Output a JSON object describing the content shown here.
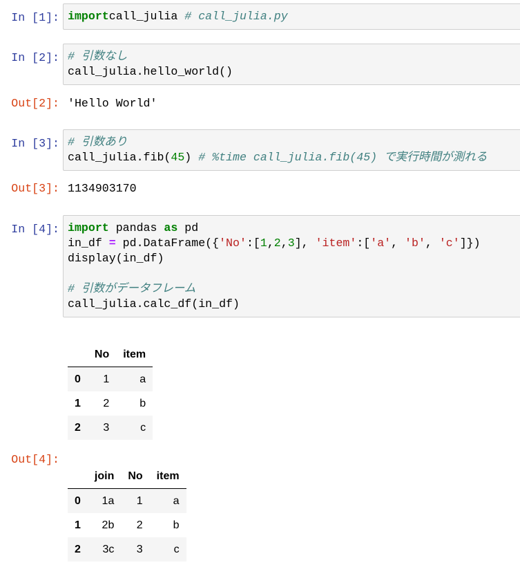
{
  "cells": [
    {
      "prompt": "In [1]:",
      "lines": [
        [
          [
            "kw",
            "import"
          ],
          [
            "",
            "call_julia "
          ],
          [
            "cm",
            "# call_julia.py"
          ]
        ]
      ]
    },
    {
      "prompt": "In [2]:",
      "lines": [
        [
          [
            "cm",
            "# 引数なし"
          ]
        ],
        [
          [
            "",
            "call_julia.hello_world()"
          ]
        ]
      ],
      "out_prompt": "Out[2]:",
      "output": "'Hello World'"
    },
    {
      "prompt": "In [3]:",
      "lines": [
        [
          [
            "cm",
            "# 引数あり"
          ]
        ],
        [
          [
            "",
            "call_julia.fib("
          ],
          [
            "nm",
            "45"
          ],
          [
            "",
            ") "
          ],
          [
            "cm",
            "# %time call_julia.fib(45) で実行時間が測れる"
          ]
        ]
      ],
      "out_prompt": "Out[3]:",
      "output": "1134903170"
    },
    {
      "prompt": "In [4]:",
      "lines": [
        [
          [
            "kw",
            "import"
          ],
          [
            "",
            " pandas "
          ],
          [
            "kw",
            "as"
          ],
          [
            "",
            " pd"
          ]
        ],
        [
          [
            "",
            "in_df "
          ],
          [
            "op",
            "="
          ],
          [
            "",
            " pd.DataFrame({"
          ],
          [
            "st",
            "'No'"
          ],
          [
            "",
            ":["
          ],
          [
            "nm",
            "1"
          ],
          [
            "",
            ","
          ],
          [
            "nm",
            "2"
          ],
          [
            "",
            ","
          ],
          [
            "nm",
            "3"
          ],
          [
            "",
            "], "
          ],
          [
            "st",
            "'item'"
          ],
          [
            "",
            ":["
          ],
          [
            "st",
            "'a'"
          ],
          [
            "",
            ", "
          ],
          [
            "st",
            "'b'"
          ],
          [
            "",
            ", "
          ],
          [
            "st",
            "'c'"
          ],
          [
            "",
            "]})"
          ]
        ],
        [
          [
            "",
            "display(in_df)"
          ]
        ],
        [],
        [
          [
            "cm",
            "# 引数がデータフレーム"
          ]
        ],
        [
          [
            "",
            "call_julia.calc_df(in_df)"
          ]
        ]
      ],
      "out_prompt": "Out[4]:"
    }
  ],
  "display_table": {
    "columns": [
      "",
      "No",
      "item"
    ],
    "rows": [
      [
        "0",
        "1",
        "a"
      ],
      [
        "1",
        "2",
        "b"
      ],
      [
        "2",
        "3",
        "c"
      ]
    ]
  },
  "out_table": {
    "columns": [
      "",
      "join",
      "No",
      "item"
    ],
    "rows": [
      [
        "0",
        "1a",
        "1",
        "a"
      ],
      [
        "1",
        "2b",
        "2",
        "b"
      ],
      [
        "2",
        "3c",
        "3",
        "c"
      ]
    ]
  }
}
